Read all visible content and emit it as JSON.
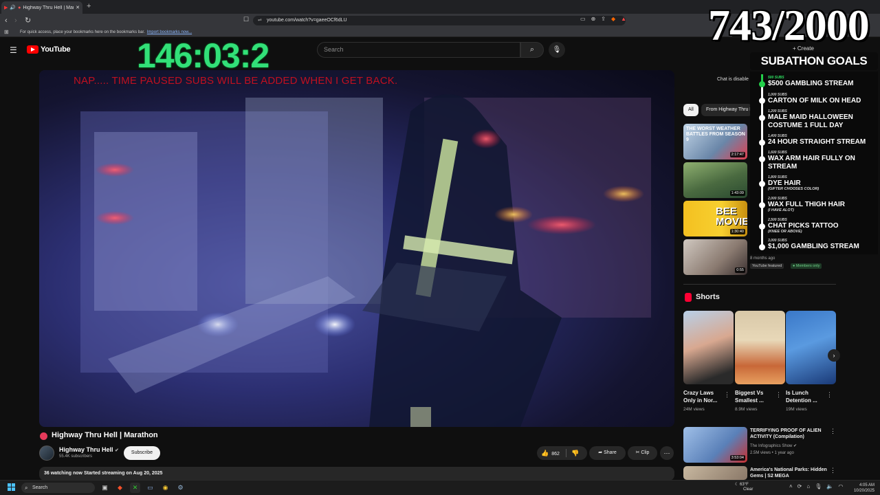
{
  "browser": {
    "tab_title": "Highway Thru Hell | Mara",
    "url": "youtube.com/watch?v=gaeeOCf6dLU",
    "bookmarks_text": "For quick access, place your bookmarks here on the bookmarks bar.",
    "bookmarks_link": "Import bookmarks now..."
  },
  "header": {
    "logo": "YouTube",
    "search_placeholder": "Search",
    "create_label": "+ Create"
  },
  "overlay": {
    "timer": "146:03:2",
    "counter": "743/2000",
    "goals_title": "SUBATHON GOALS",
    "goals": [
      {
        "subs": "500 SUBS",
        "label": "$500 GAMBLING STREAM",
        "note": ""
      },
      {
        "subs": "1,000 SUBS",
        "label": "CARTON OF MILK ON HEAD",
        "note": ""
      },
      {
        "subs": "1,200 SUBS",
        "label": "MALE MAID HALLOWEEN COSTUME 1 FULL DAY",
        "note": ""
      },
      {
        "subs": "1,400 SUBS",
        "label": "24 HOUR STRAIGHT STREAM",
        "note": ""
      },
      {
        "subs": "1,600 SUBS",
        "label": "WAX ARM HAIR FULLY ON STREAM",
        "note": ""
      },
      {
        "subs": "1,800 SUBS",
        "label": "DYE HAIR",
        "note": "(GIFTER CHOOSES COLOR)"
      },
      {
        "subs": "2,000 SUBS",
        "label": "WAX FULL THIGH HAIR",
        "note": "(I HAVE ALOT)"
      },
      {
        "subs": "2,500 SUBS",
        "label": "CHAT PICKS TATTOO",
        "note": "(KNEE OR ABOVE)"
      },
      {
        "subs": "3,000 SUBS",
        "label": "$1,000 GAMBLING STREAM",
        "note": ""
      }
    ]
  },
  "video": {
    "overlay_text": "NAP.....  TIME PAUSED SUBS WILL BE ADDED WHEN I GET BACK.",
    "title": "Highway Thru Hell | Marathon",
    "channel": "Highway Thru Hell",
    "subscribers": "55.4K subscribers",
    "subscribe_label": "Subscribe",
    "likes": "862",
    "share_label": "Share",
    "clip_label": "Clip",
    "description": "36 watching now  Started streaming on Aug 20, 2025"
  },
  "sidebar": {
    "chat_disabled": "Chat is disable",
    "chips": [
      "All",
      "From Highway Thru Hell"
    ],
    "thumbs": [
      {
        "duration": "2:17:47",
        "text": "THE WORST WEATHER BATTLES FROM SEASON 9"
      },
      {
        "duration": "1:43:09",
        "text": ""
      },
      {
        "duration": "1:30:40",
        "text": "BEE MOVIE"
      },
      {
        "duration": "0:55",
        "text": ""
      }
    ],
    "last_meta": "8 months ago",
    "featured": "YouTube featured",
    "members": "Members only",
    "shorts_title": "Shorts",
    "shorts": [
      {
        "title": "Crazy Laws Only in Nor...",
        "views": "24M views"
      },
      {
        "title": "Biggest Vs Smallest ...",
        "views": "8.9M views"
      },
      {
        "title": "Is Lunch Detention ...",
        "views": "19M views"
      }
    ],
    "videos": [
      {
        "title": "TERRIFYING PROOF OF ALIEN ACTIVITY (Compilation)",
        "channel": "The Infographics Show",
        "meta": "2.5M views • 1 year ago",
        "duration": "3:53:04"
      },
      {
        "title": "America's National Parks: Hidden Gems | S2 MEGA",
        "channel": "",
        "meta": "",
        "duration": ""
      }
    ]
  },
  "taskbar": {
    "search": "Search",
    "weather_temp": "63°F",
    "weather_desc": "Clear",
    "time": "4:05 AM",
    "date": "10/20/2025"
  },
  "colors": {
    "timer": "#32e078",
    "overlay_text": "#c01020",
    "goal_done": "#23d04a",
    "yt_red": "#ff0000"
  }
}
